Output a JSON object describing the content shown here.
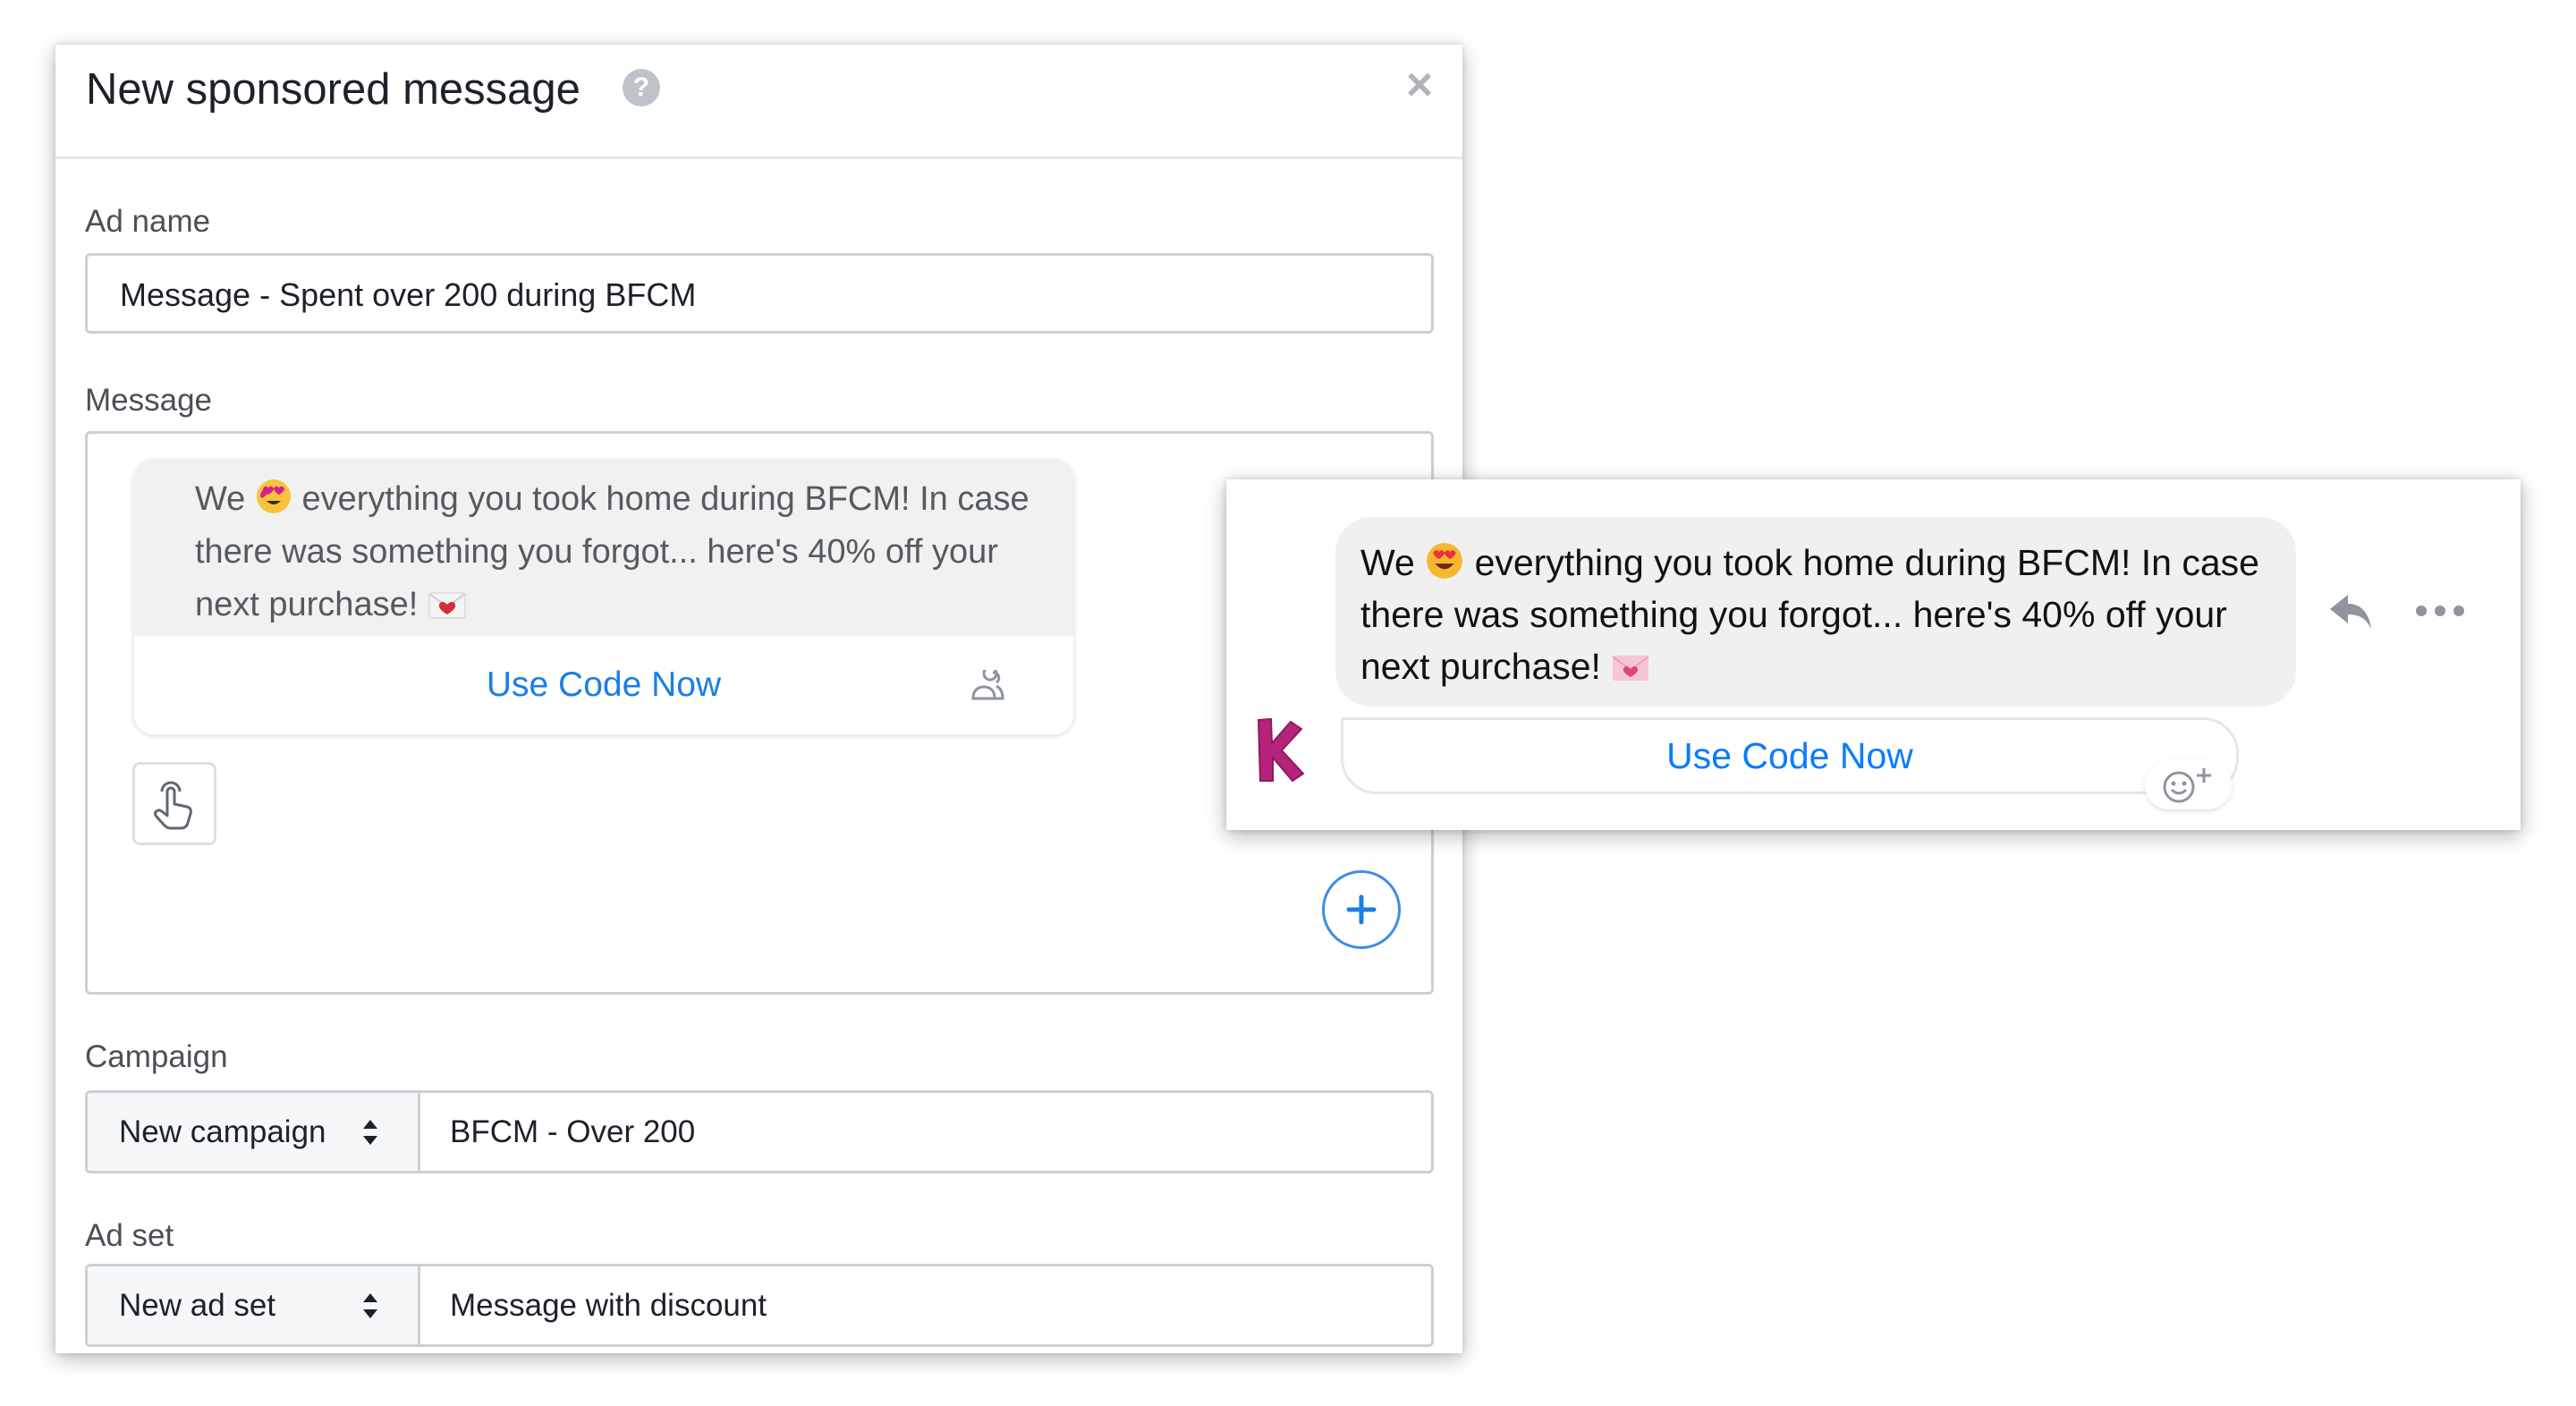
{
  "dialog": {
    "title": "New sponsored message",
    "help_icon": "question-circle-icon",
    "close_icon": "close-icon"
  },
  "ad_name": {
    "label": "Ad name",
    "value": "Message - Spent over 200 during BFCM"
  },
  "message": {
    "label": "Message",
    "text_before_emoji": "We",
    "emoji_1": "heart-eyes-emoji",
    "text_after_emoji": "everything you took home during BFCM! In case there was something you forgot... here's 40% off your next purchase!",
    "emoji_2": "love-letter-emoji",
    "button_label": "Use Code Now",
    "audience_icon": "people-icon",
    "touch_icon": "tap-gesture-icon",
    "add_icon": "plus-circle-icon"
  },
  "campaign": {
    "label": "Campaign",
    "select_value": "New campaign",
    "value": "BFCM - Over 200"
  },
  "ad_set": {
    "label": "Ad set",
    "select_value": "New ad set",
    "value": "Message with discount"
  },
  "preview": {
    "text_before_emoji": "We",
    "emoji_1": "heart-eyes-emoji",
    "text_after_emoji": "everything you took home during BFCM! In case there was something you forgot... here's 40% off your next purchase!",
    "emoji_2": "love-letter-emoji",
    "button_label": "Use Code Now",
    "brand_logo": "K",
    "reply_icon": "reply-icon",
    "more_icon": "more-dots-icon",
    "react_icon": "add-reaction-icon"
  },
  "colors": {
    "link_blue": "#1a7ee6",
    "messenger_blue": "#0a7cff",
    "brand_magenta": "#b5247a"
  }
}
